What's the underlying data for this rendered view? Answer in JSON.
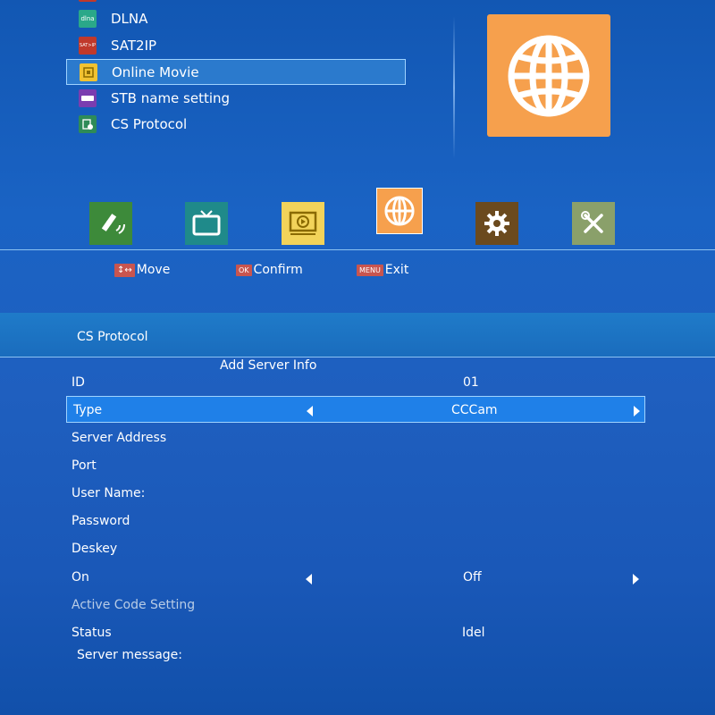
{
  "menu": {
    "items": [
      {
        "label": "DLNA",
        "icon": "dlna-icon",
        "icon_text": "dlna",
        "color": "#2aa889"
      },
      {
        "label": "SAT2IP",
        "icon": "sat2ip-icon",
        "icon_text": "SAT>IP",
        "color": "#c0392b"
      },
      {
        "label": "Online Movie",
        "icon": "online-movie-icon",
        "icon_text": "",
        "color": "#f1c232",
        "selected": true
      },
      {
        "label": "STB name setting",
        "icon": "stb-name-icon",
        "icon_text": "",
        "color": "#7a3db0"
      },
      {
        "label": "CS Protocol",
        "icon": "cs-protocol-icon",
        "icon_text": "",
        "color": "#2e8b57"
      }
    ],
    "preview_icon": "globe-icon",
    "preview_color": "#f6a04d"
  },
  "categories": [
    {
      "name": "satellite-icon",
      "color": "#3d8a3a"
    },
    {
      "name": "tv-icon",
      "color": "#1f8a8a"
    },
    {
      "name": "media-player-icon",
      "color": "#f2d35a"
    },
    {
      "name": "globe-icon",
      "color": "#f6a04d",
      "active": true
    },
    {
      "name": "gear-icon",
      "color": "#6b4a1e"
    },
    {
      "name": "tools-icon",
      "color": "#8aa06a"
    }
  ],
  "hints": [
    {
      "key": "",
      "label": "Move",
      "icon": "move-icon"
    },
    {
      "key": "OK",
      "label": "Confirm"
    },
    {
      "key": "MENU",
      "label": "Exit"
    }
  ],
  "panel": {
    "title": "CS Protocol",
    "subtitle": "Add Server Info",
    "id_label": "ID",
    "id_value": "01",
    "rows": [
      {
        "label": "Type",
        "value": "CCCam",
        "selector": true,
        "selected": true
      },
      {
        "label": "Server Address",
        "value": ""
      },
      {
        "label": "Port",
        "value": ""
      },
      {
        "label": "User Name:",
        "value": ""
      },
      {
        "label": "Password",
        "value": ""
      },
      {
        "label": "Deskey",
        "value": ""
      },
      {
        "label": "On",
        "value": "Off",
        "selector": true
      },
      {
        "label": "Active Code Setting",
        "value": "",
        "disabled": true
      },
      {
        "label": "Status",
        "value": "Idel"
      }
    ],
    "server_message_label": "Server message:"
  }
}
